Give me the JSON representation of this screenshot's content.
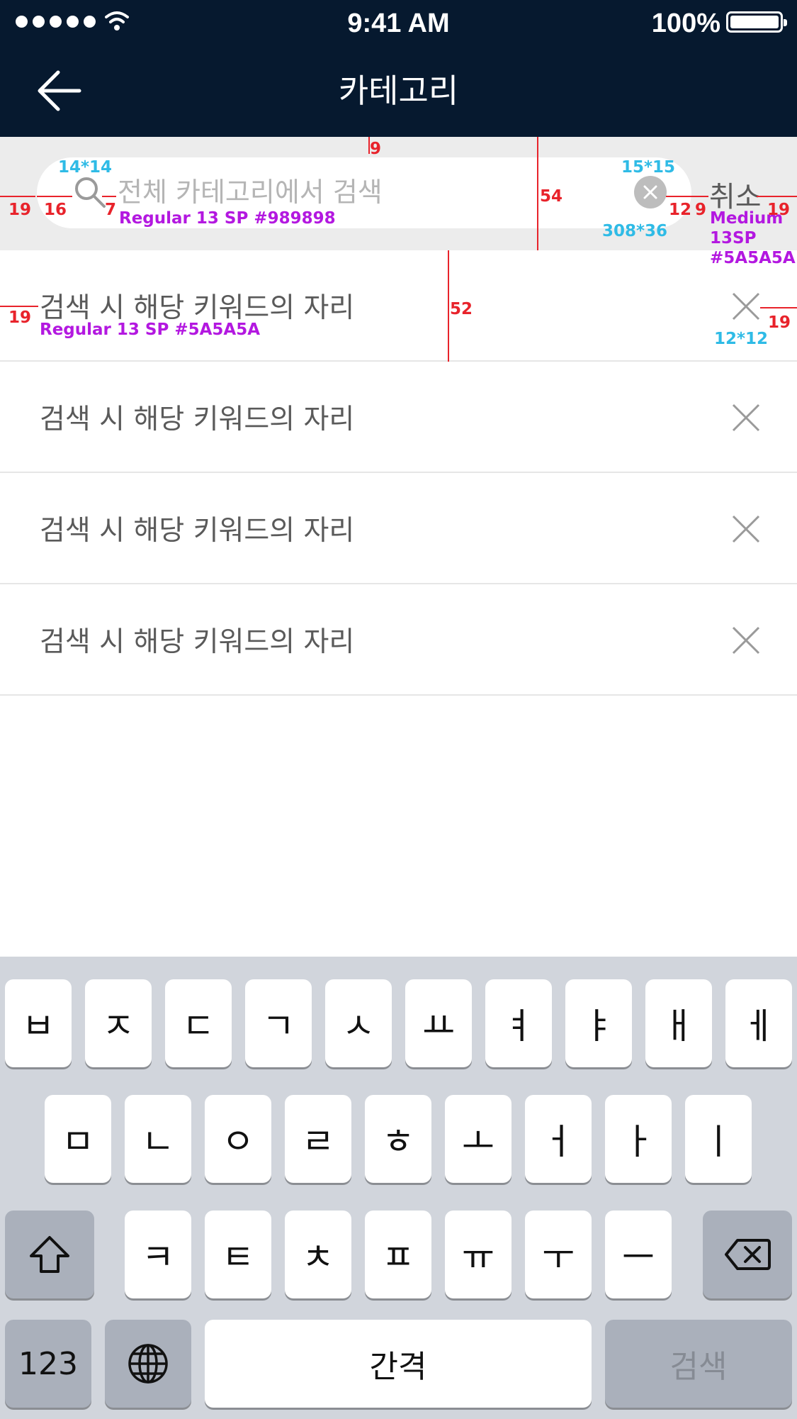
{
  "status_bar": {
    "time": "9:41 AM",
    "battery": "100%"
  },
  "header": {
    "title": "카테고리"
  },
  "search": {
    "placeholder": "전체 카테고리에서 검색",
    "cancel_label": "취소"
  },
  "annotations": {
    "search_icon_size": "14*14",
    "placeholder_spec": "Regular 13 SP #989898",
    "clear_icon_size": "15*15",
    "field_size": "308*36",
    "cancel_spec_line1": "Medium",
    "cancel_spec_line2": "13SP",
    "cancel_spec_line3": "#5A5A5A",
    "top_gap": "9",
    "bar_height": "54",
    "left_margin": "19",
    "icon_left_pad": "16",
    "icon_text_gap": "7",
    "clear_right_pad": "12",
    "cancel_gap": "9",
    "right_margin": "19",
    "row_left_margin": "19",
    "row_text_spec": "Regular 13 SP #5A5A5A",
    "row_height": "52",
    "row_right_margin": "19",
    "row_x_size": "12*12"
  },
  "history": [
    {
      "keyword": "검색 시 해당 키워드의 자리"
    },
    {
      "keyword": "검색 시 해당 키워드의 자리"
    },
    {
      "keyword": "검색 시 해당 키워드의 자리"
    },
    {
      "keyword": "검색 시 해당 키워드의 자리"
    }
  ],
  "keyboard": {
    "row1": [
      "ㅂ",
      "ㅈ",
      "ㄷ",
      "ㄱ",
      "ㅅ",
      "ㅛ",
      "ㅕ",
      "ㅑ",
      "ㅐ",
      "ㅔ"
    ],
    "row2": [
      "ㅁ",
      "ㄴ",
      "ㅇ",
      "ㄹ",
      "ㅎ",
      "ㅗ",
      "ㅓ",
      "ㅏ",
      "ㅣ"
    ],
    "row3": [
      "ㅋ",
      "ㅌ",
      "ㅊ",
      "ㅍ",
      "ㅠ",
      "ㅜ",
      "ㅡ"
    ],
    "numbers_label": "123",
    "space_label": "간격",
    "search_label": "검색",
    "shift_icon": "shift-icon",
    "delete_icon": "backspace-icon",
    "globe_icon": "globe-icon"
  }
}
